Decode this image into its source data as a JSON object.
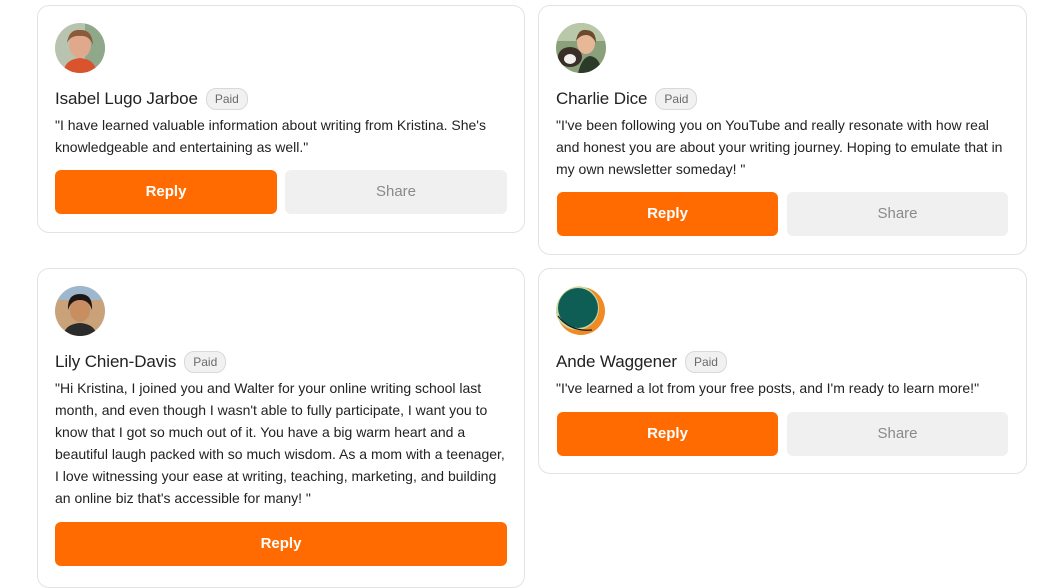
{
  "cards": [
    {
      "name": "Isabel Lugo Jarboe",
      "badge": "Paid",
      "quote": "\"I have learned valuable information about writing from Kristina. She's knowledgeable and entertaining as well.\"",
      "reply_label": "Reply",
      "share_label": "Share"
    },
    {
      "name": "Charlie Dice",
      "badge": "Paid",
      "quote": "\"I've been following you on YouTube and really resonate with how real and honest you are about your writing journey. Hoping to emulate that in my own newsletter someday! \"",
      "reply_label": "Reply",
      "share_label": "Share"
    },
    {
      "name": "Lily Chien-Davis",
      "badge": "Paid",
      "quote": "\"Hi Kristina, I joined you and Walter for your online writing school last month, and even though I wasn't able to fully participate, I want you to know that I got so much out of it. You have a big warm heart and a beautiful laugh packed with so much wisdom. As a mom with a teenager, I love witnessing your ease at writing, teaching, marketing, and building an online biz that's accessible for many! \"",
      "reply_label": "Reply"
    },
    {
      "name": "Ande Waggener",
      "badge": "Paid",
      "quote": "\"I've learned a lot from your free posts, and I'm ready to learn more!\"",
      "reply_label": "Reply",
      "share_label": "Share"
    }
  ],
  "colors": {
    "accent": "#ff6b00",
    "share_bg": "#f0f0f0",
    "border": "#e3e3e3"
  }
}
